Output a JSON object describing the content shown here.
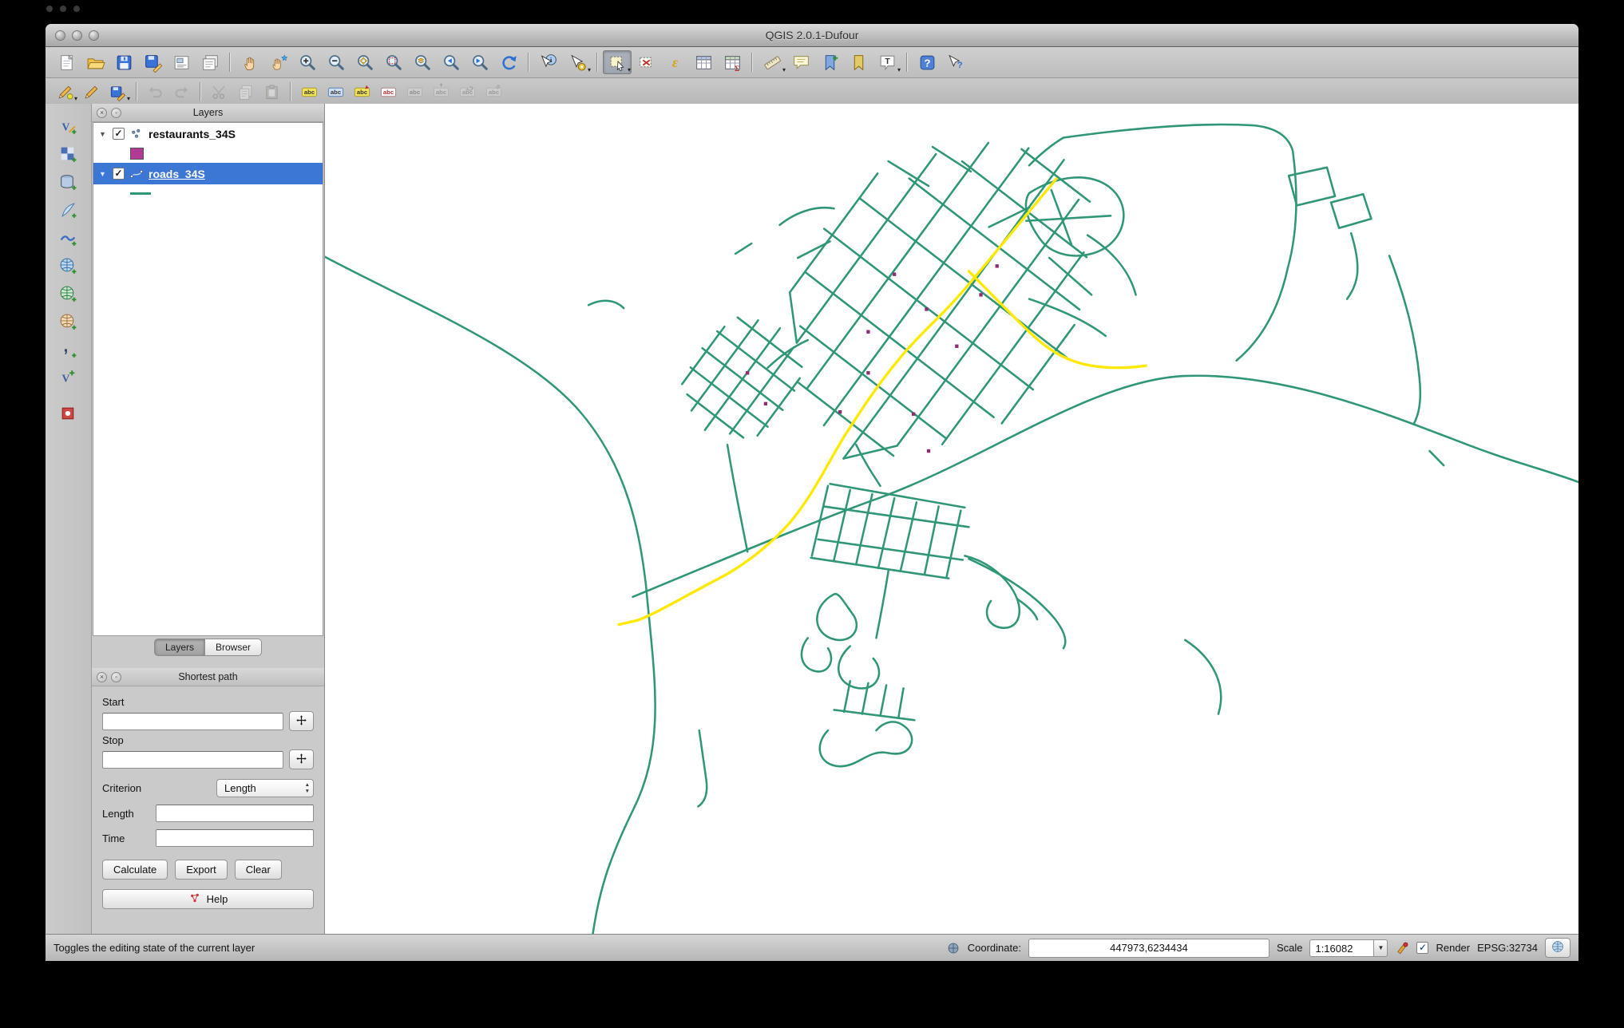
{
  "window": {
    "title": "QGIS 2.0.1-Dufour"
  },
  "toolbars": {
    "main": [
      {
        "name": "new-project",
        "icon": "doc"
      },
      {
        "name": "open-project",
        "icon": "folder"
      },
      {
        "name": "save-project",
        "icon": "disk"
      },
      {
        "name": "save-project-as",
        "icon": "disk-as"
      },
      {
        "name": "new-print-composer",
        "icon": "composer"
      },
      {
        "name": "composer-manager",
        "icon": "composer2"
      },
      {
        "sep": true
      },
      {
        "name": "pan-map",
        "icon": "hand"
      },
      {
        "name": "pan-to-selection",
        "icon": "hand-star"
      },
      {
        "name": "zoom-in",
        "icon": "mag-plus"
      },
      {
        "name": "zoom-out",
        "icon": "mag-minus"
      },
      {
        "name": "zoom-full",
        "icon": "mag-full"
      },
      {
        "name": "zoom-to-selection",
        "icon": "mag-sel"
      },
      {
        "name": "zoom-to-layer",
        "icon": "mag-layer"
      },
      {
        "name": "zoom-last",
        "icon": "mag-left"
      },
      {
        "name": "zoom-next",
        "icon": "mag-right"
      },
      {
        "name": "refresh-map",
        "icon": "refresh"
      },
      {
        "sep": true
      },
      {
        "name": "identify-features",
        "icon": "identify"
      },
      {
        "name": "run-feature-action",
        "icon": "action",
        "dropdown": true
      },
      {
        "sep": true
      },
      {
        "name": "select-features",
        "icon": "select",
        "active": true,
        "dropdown": true
      },
      {
        "name": "deselect-all",
        "icon": "deselect"
      },
      {
        "name": "select-by-expression",
        "icon": "epsilon"
      },
      {
        "name": "open-attribute-table",
        "icon": "table"
      },
      {
        "name": "field-calculator",
        "icon": "table-calc"
      },
      {
        "sep": true
      },
      {
        "name": "measure-line",
        "icon": "ruler",
        "dropdown": true
      },
      {
        "name": "map-tips",
        "icon": "bubble"
      },
      {
        "name": "new-bookmark",
        "icon": "bookmark-new"
      },
      {
        "name": "show-bookmarks",
        "icon": "bookmark"
      },
      {
        "name": "text-annotation",
        "icon": "annot",
        "dropdown": true
      },
      {
        "sep": true
      },
      {
        "name": "help-contents",
        "icon": "help"
      },
      {
        "name": "whats-this",
        "icon": "whatsthis"
      }
    ],
    "edit": [
      {
        "name": "current-edits",
        "icon": "pencil-cur",
        "dropdown": true
      },
      {
        "name": "toggle-editing",
        "icon": "pencil"
      },
      {
        "name": "save-layer-edits",
        "icon": "disk-pencil",
        "dropdown": true
      },
      {
        "sep": true
      },
      {
        "name": "undo",
        "icon": "undo",
        "disabled": true
      },
      {
        "name": "redo",
        "icon": "redo",
        "disabled": true
      },
      {
        "sep": true
      },
      {
        "name": "cut-features",
        "icon": "scissors",
        "disabled": true
      },
      {
        "name": "copy-features",
        "icon": "copy",
        "disabled": true
      },
      {
        "name": "paste-features",
        "icon": "paste",
        "disabled": true
      },
      {
        "sep": true
      },
      {
        "name": "layer-labeling-options",
        "icon": "abc"
      },
      {
        "name": "label-configuration",
        "icon": "abc-blue"
      },
      {
        "name": "pin-labels",
        "icon": "abc-pin"
      },
      {
        "name": "highlight-labels",
        "icon": "abc-red"
      },
      {
        "name": "show-hide-labels",
        "icon": "abc-gray",
        "disabled": true
      },
      {
        "name": "move-label",
        "icon": "abc-move",
        "disabled": true
      },
      {
        "name": "rotate-label",
        "icon": "abc-rot",
        "disabled": true
      },
      {
        "name": "change-label",
        "icon": "abc-chg",
        "disabled": true
      }
    ],
    "left": [
      {
        "name": "add-vector-layer",
        "icon": "vlayer"
      },
      {
        "name": "add-raster-layer",
        "icon": "checker"
      },
      {
        "name": "add-postgis-layer",
        "icon": "db"
      },
      {
        "name": "add-spatialite-layer",
        "icon": "feather"
      },
      {
        "name": "add-mssql-layer",
        "icon": "wave"
      },
      {
        "name": "add-wms-layer",
        "icon": "globe"
      },
      {
        "name": "add-wcs-layer",
        "icon": "globe2"
      },
      {
        "name": "add-wfs-layer",
        "icon": "globe3"
      },
      {
        "name": "add-delimited-text-layer",
        "icon": "comma"
      },
      {
        "name": "new-shapefile-layer",
        "icon": "vnew"
      },
      {
        "name": "add-oracle-layer",
        "icon": "redsq"
      }
    ]
  },
  "layers_panel": {
    "title": "Layers",
    "items": [
      {
        "name": "restaurants_34S",
        "checked": true,
        "selected": false,
        "swatch_type": "point",
        "swatch_color": "#b23a94"
      },
      {
        "name": "roads_34S",
        "checked": true,
        "selected": true,
        "swatch_type": "line",
        "swatch_color": "#2f9678"
      }
    ],
    "tabs": [
      {
        "label": "Layers",
        "active": true
      },
      {
        "label": "Browser",
        "active": false
      }
    ]
  },
  "shortest_path": {
    "title": "Shortest path",
    "start_label": "Start",
    "start_value": "",
    "stop_label": "Stop",
    "stop_value": "",
    "criterion_label": "Criterion",
    "criterion_value": "Length",
    "length_label": "Length",
    "length_value": "",
    "time_label": "Time",
    "time_value": "",
    "buttons": {
      "calculate": "Calculate",
      "export": "Export",
      "clear": "Clear",
      "help": "Help"
    }
  },
  "status_bar": {
    "hint": "Toggles the editing state of the current layer",
    "coordinate_label": "Coordinate:",
    "coordinate_value": "447973,6234434",
    "scale_label": "Scale",
    "scale_value": "1:16082",
    "render_label": "Render",
    "render_checked": true,
    "crs_label": "EPSG:32734"
  },
  "map": {
    "visible_layers": [
      "restaurants_34S",
      "roads_34S"
    ],
    "colors": {
      "road": "#2f9678",
      "route": "#ffe900",
      "restaurant": "#8c2d74",
      "selection_blue": "#3c77d6"
    }
  }
}
